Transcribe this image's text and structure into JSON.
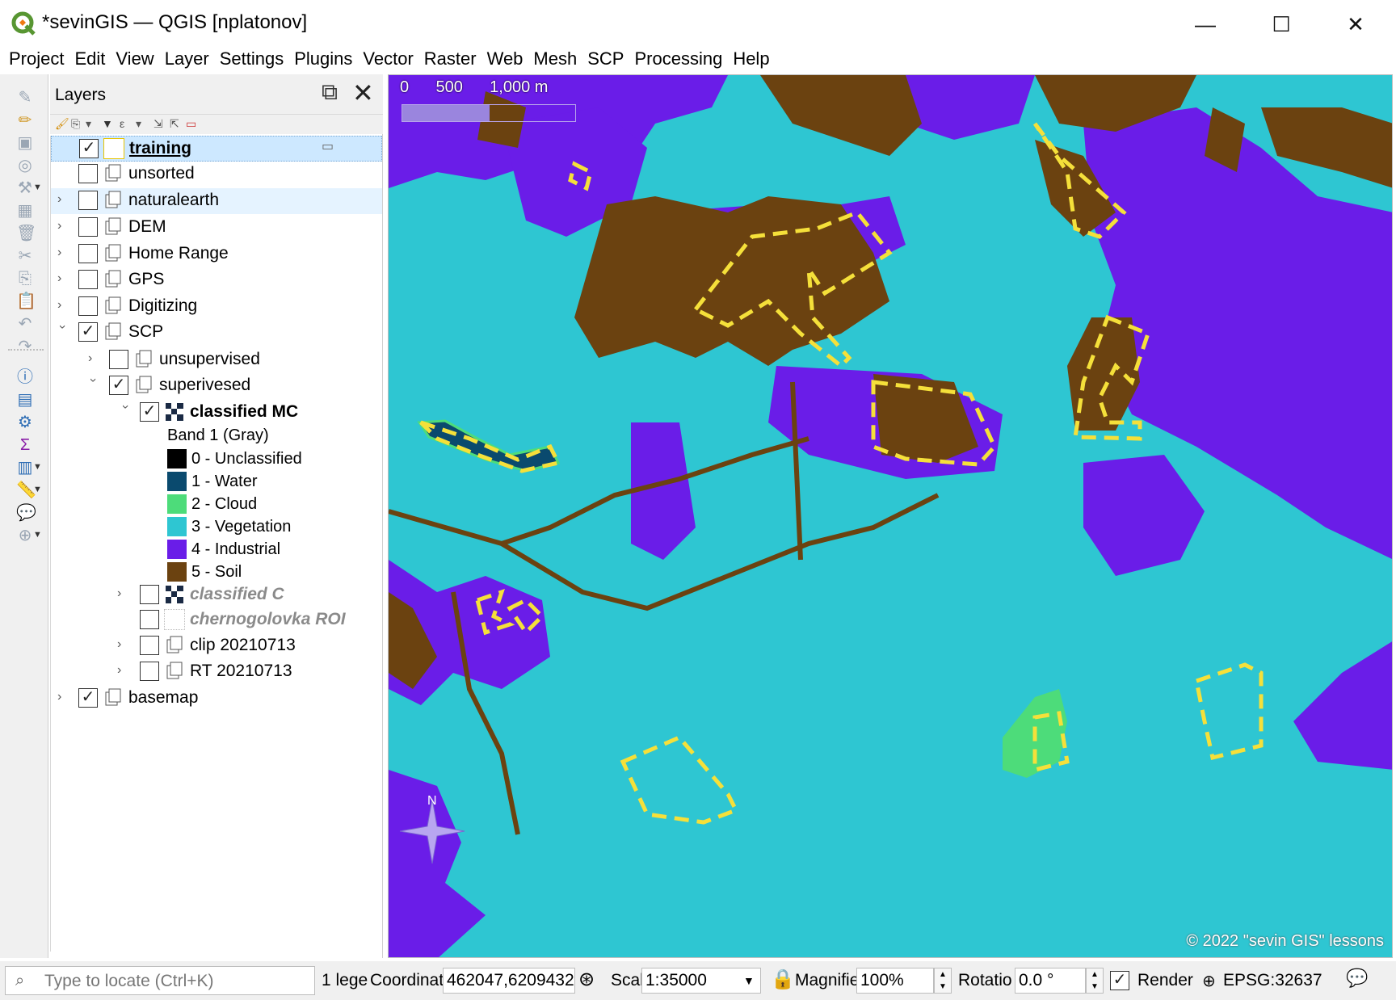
{
  "window": {
    "title": "*sevinGIS — QGIS [nplatonov]",
    "minimize": "—",
    "maximize": "☐",
    "close": "✕"
  },
  "menu": [
    "Project",
    "Edit",
    "View",
    "Layer",
    "Settings",
    "Plugins",
    "Vector",
    "Raster",
    "Web",
    "Mesh",
    "SCP",
    "Processing",
    "Help"
  ],
  "layers_panel": {
    "title": "Layers",
    "float_icon": "⧉",
    "close_icon": "✕",
    "layers": [
      {
        "label": "training",
        "checked": "✓"
      },
      {
        "label": "unsorted",
        "checked": ""
      },
      {
        "label": "naturalearth",
        "checked": ""
      },
      {
        "label": "DEM",
        "checked": ""
      },
      {
        "label": "Home Range",
        "checked": ""
      },
      {
        "label": "GPS",
        "checked": ""
      },
      {
        "label": "Digitizing",
        "checked": ""
      },
      {
        "label": "SCP",
        "checked": "✓"
      },
      {
        "label": "unsupervised",
        "checked": ""
      },
      {
        "label": "superivesed",
        "checked": "✓"
      },
      {
        "label": "classified MC",
        "checked": "✓"
      },
      {
        "label": "classified C",
        "checked": ""
      },
      {
        "label": "chernogolovka ROI",
        "checked": ""
      },
      {
        "label": "clip 20210713",
        "checked": ""
      },
      {
        "label": "RT 20210713",
        "checked": ""
      },
      {
        "label": "basemap",
        "checked": "✓"
      }
    ],
    "band_label": "Band 1 (Gray)",
    "legend": [
      {
        "label": "0 - Unclassified",
        "color": "#000000"
      },
      {
        "label": "1 - Water",
        "color": "#0a4a6e"
      },
      {
        "label": "2 - Cloud",
        "color": "#4ddc7a"
      },
      {
        "label": "3 - Vegetation",
        "color": "#2ec6d2"
      },
      {
        "label": "4 - Industrial",
        "color": "#6a1de8"
      },
      {
        "label": "5 - Soil",
        "color": "#6b4210"
      }
    ]
  },
  "map": {
    "scale_labels": "0      500      1,000 m",
    "copyright": "© 2022 \"sevin GIS\" lessons",
    "north": "N",
    "colors": {
      "vegetation": "#2ec6d2",
      "industrial": "#6a1de8",
      "soil": "#6b4210",
      "water": "#0a4a6e",
      "cloud": "#4ddc7a",
      "training_outline": "#f5e03a"
    }
  },
  "status": {
    "locate_placeholder": "Type to locate (Ctrl+K)",
    "legend_msg": "1 lege",
    "coord_label": "Coordinat",
    "coordinate": "462047,6209432",
    "scale_label": "Scal",
    "scale": "1:35000",
    "magnifier_label": "Magnifie",
    "magnifier": "100%",
    "rotation_label": "Rotatio",
    "rotation": "0.0 °",
    "render_label": "Render",
    "render_checked": "✓",
    "crs": "EPSG:32637"
  }
}
